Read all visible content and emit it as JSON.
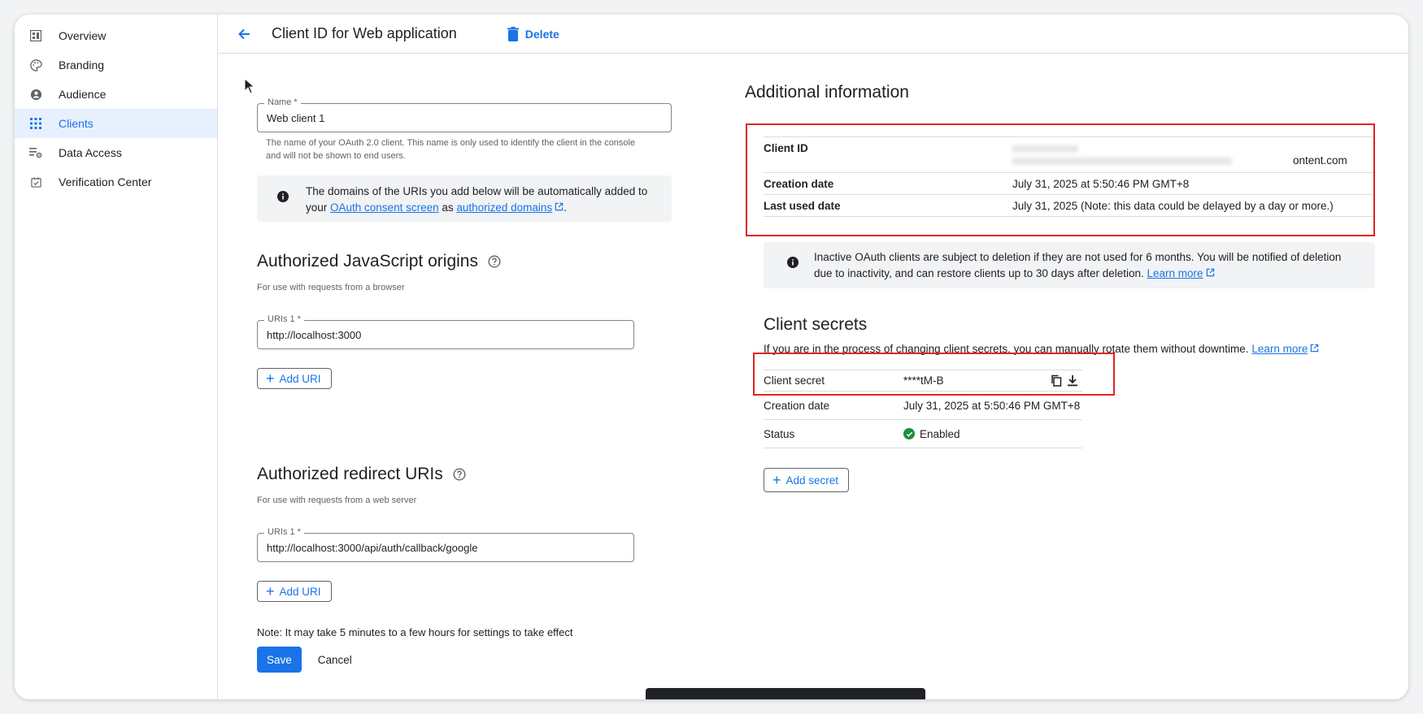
{
  "sidebar": {
    "items": [
      {
        "label": "Overview",
        "icon": "dashboard-icon"
      },
      {
        "label": "Branding",
        "icon": "palette-icon"
      },
      {
        "label": "Audience",
        "icon": "person-icon"
      },
      {
        "label": "Clients",
        "icon": "apps-grid-icon",
        "active": true
      },
      {
        "label": "Data Access",
        "icon": "data-access-icon"
      },
      {
        "label": "Verification Center",
        "icon": "verified-icon"
      }
    ]
  },
  "header": {
    "title": "Client ID for Web application",
    "delete_label": "Delete"
  },
  "form": {
    "name_label": "Name *",
    "name_value": "Web client 1",
    "name_hint": "The name of your OAuth 2.0 client. This name is only used to identify the client in the console and will not be shown to end users.",
    "domains_info": {
      "prefix": "The domains of the URIs you add below will be automatically added to your ",
      "consent_link": "OAuth consent screen",
      "middle": " as ",
      "domains_link": "authorized domains",
      "suffix": "."
    },
    "js_origins": {
      "title": "Authorized JavaScript origins",
      "subtitle": "For use with requests from a browser",
      "uri_label": "URIs 1 *",
      "uri_value": "http://localhost:3000",
      "add_label": "Add URI"
    },
    "redirect_uris": {
      "title": "Authorized redirect URIs",
      "subtitle": "For use with requests from a web server",
      "uri_label": "URIs 1 *",
      "uri_value": "http://localhost:3000/api/auth/callback/google",
      "add_label": "Add URI"
    },
    "note": "Note: It may take 5 minutes to a few hours for settings to take effect",
    "save_label": "Save",
    "cancel_label": "Cancel"
  },
  "additional": {
    "title": "Additional information",
    "client_id_label": "Client ID",
    "client_id_visible_suffix": "ontent.com",
    "creation_label": "Creation date",
    "creation_value": "July 31, 2025 at 5:50:46 PM GMT+8",
    "last_used_label": "Last used date",
    "last_used_value": "July 31, 2025 (Note: this data could be delayed by a day or more.)",
    "inactive_info": "Inactive OAuth clients are subject to deletion if they are not used for 6 months. You will be notified of deletion due to inactivity, and can restore clients up to 30 days after deletion. ",
    "inactive_link": "Learn more"
  },
  "secrets": {
    "title": "Client secrets",
    "description": "If you are in the process of changing client secrets, you can manually rotate them without downtime. ",
    "description_link": "Learn more",
    "secret_label": "Client secret",
    "secret_value": "****tM-B",
    "creation_label": "Creation date",
    "creation_value": "July 31, 2025 at 5:50:46 PM GMT+8",
    "status_label": "Status",
    "status_value": "Enabled",
    "add_label": "Add secret"
  },
  "colors": {
    "accent": "#1a73e8",
    "highlight": "#e02424",
    "enabled": "#1e8e3e"
  }
}
